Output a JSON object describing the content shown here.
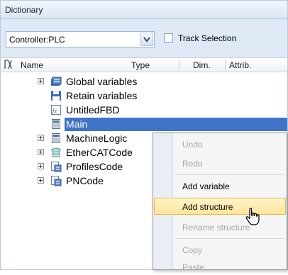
{
  "panel": {
    "title": "Dictionary"
  },
  "toolbar": {
    "controller_select_value": "Controller:PLC",
    "track_selection_label": "Track Selection",
    "track_selection_checked": false
  },
  "grid": {
    "columns": [
      "Name",
      "Type",
      "Dim.",
      "Attrib."
    ]
  },
  "tree": {
    "items": [
      {
        "label": "Global variables",
        "icon": "global-variables-icon",
        "expandable": true
      },
      {
        "label": "Retain variables",
        "icon": "save-disk-icon",
        "expandable": false
      },
      {
        "label": "UntitledFBD",
        "icon": "fbd-program-icon",
        "expandable": false
      },
      {
        "label": "Main",
        "icon": "program-icon",
        "expandable": false,
        "selected": true
      },
      {
        "label": "MachineLogic",
        "icon": "program-icon",
        "expandable": true
      },
      {
        "label": "EtherCATCode",
        "icon": "ethercat-icon",
        "expandable": true
      },
      {
        "label": "ProfilesCode",
        "icon": "fb-code-icon",
        "expandable": true
      },
      {
        "label": "PNCode",
        "icon": "fb-code-icon",
        "expandable": true
      }
    ]
  },
  "context_menu": {
    "items": [
      {
        "label": "Undo",
        "enabled": false
      },
      {
        "label": "Redo",
        "enabled": false
      },
      {
        "label": "Add variable",
        "enabled": true
      },
      {
        "label": "Add structure",
        "enabled": true,
        "hovered": true
      },
      {
        "label": "Rename structure",
        "enabled": false
      },
      {
        "label": "Copy",
        "enabled": false
      },
      {
        "label": "Paste",
        "enabled": false
      }
    ]
  },
  "colors": {
    "selection": "#3f73c8",
    "hover_fill": "#ffe49a",
    "toolbar_bg": "#dfe9f5"
  }
}
